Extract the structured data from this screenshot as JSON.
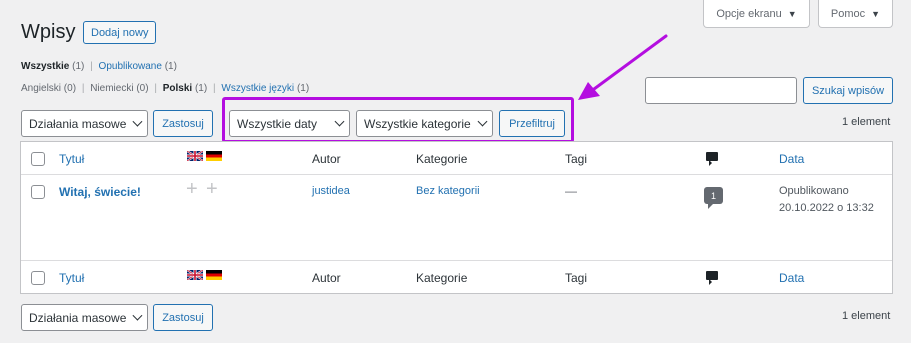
{
  "header": {
    "screen_options": "Opcje ekranu",
    "help": "Pomoc",
    "title": "Wpisy",
    "add_new": "Dodaj nowy"
  },
  "status_filter": {
    "all": "Wszystkie",
    "all_count": "(1)",
    "published": "Opublikowane",
    "published_count": "(1)"
  },
  "language_filter": {
    "english": "Angielski (0)",
    "german": "Niemiecki (0)",
    "polish": "Polski",
    "polish_count": "(1)",
    "all_languages": "Wszystkie języki",
    "all_languages_count": "(1)"
  },
  "search": {
    "button": "Szukaj wpisów",
    "value": ""
  },
  "top_nav": {
    "bulk_actions": "Działania masowe",
    "apply": "Zastosuj",
    "all_dates": "Wszystkie daty",
    "all_categories": "Wszystkie kategorie",
    "filter": "Przefiltruj",
    "items_count": "1 element"
  },
  "table": {
    "columns": {
      "title": "Tytuł",
      "author": "Autor",
      "categories": "Kategorie",
      "tags": "Tagi",
      "date": "Data"
    },
    "rows": [
      {
        "title": "Witaj, świecie!",
        "author": "justidea",
        "category": "Bez kategorii",
        "tags": "—",
        "comments": "1",
        "status": "Opublikowano",
        "date": "20.10.2022 o 13:32"
      }
    ]
  },
  "bottom_nav": {
    "bulk_actions": "Działania masowe",
    "apply": "Zastosuj",
    "items_count": "1 element"
  },
  "colors": {
    "accent": "#2271b1",
    "highlight_border": "#b40ee0",
    "arrow": "#b40ee0"
  }
}
